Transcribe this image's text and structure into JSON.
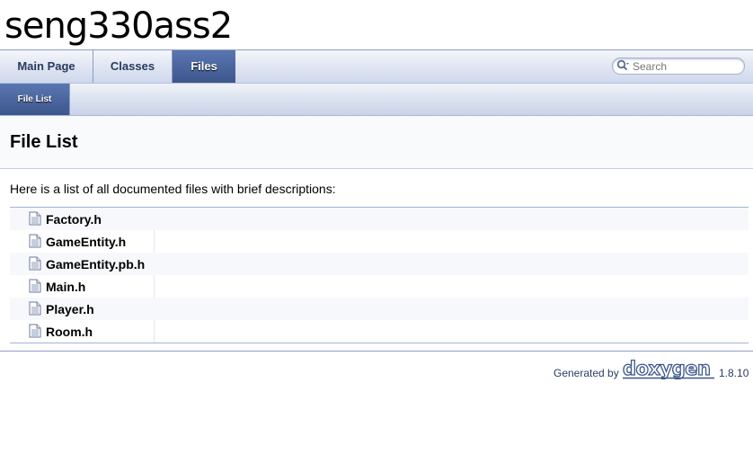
{
  "project": {
    "title": "seng330ass2"
  },
  "tabs": {
    "main_page": "Main Page",
    "classes": "Classes",
    "files": "Files"
  },
  "search": {
    "placeholder": "Search"
  },
  "subtabs": {
    "file_list": "File List"
  },
  "page": {
    "title": "File List",
    "intro": "Here is a list of all documented files with brief descriptions:"
  },
  "files": [
    "Factory.h",
    "GameEntity.h",
    "GameEntity.pb.h",
    "Main.h",
    "Player.h",
    "Room.h"
  ],
  "footer": {
    "generated_by": "Generated by",
    "logo_text": "doxygen",
    "version": "1.8.10"
  },
  "colors": {
    "active_tab": "#4665a2",
    "tab_text": "#283a5d"
  }
}
